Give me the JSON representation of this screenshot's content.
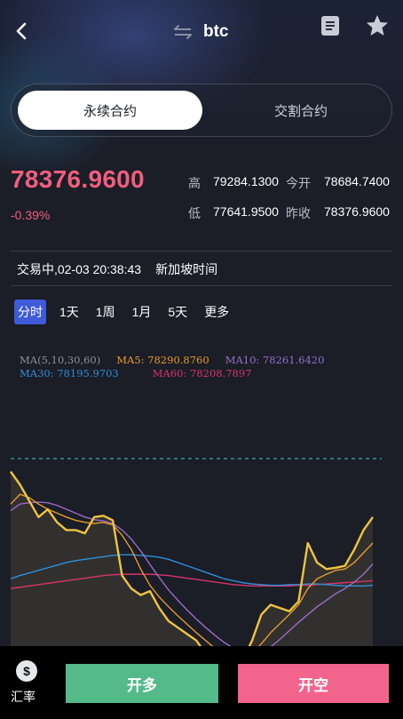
{
  "header": {
    "title": "btc",
    "back_icon": "chevron-left-icon",
    "swap_icon": "swap-arrows-icon",
    "doc_icon": "document-icon",
    "star_icon": "star-icon"
  },
  "tabs": [
    {
      "label": "永续合约",
      "active": true
    },
    {
      "label": "交割合约",
      "active": false
    }
  ],
  "quote": {
    "price": "78376.9600",
    "change": "-0.39%",
    "high_label": "高",
    "high": "79284.1300",
    "open_label": "今开",
    "open": "78684.7400",
    "low_label": "低",
    "low": "77641.9500",
    "prev_close_label": "昨收",
    "prev_close": "78376.9600"
  },
  "status": {
    "text": "交易中,02-03 20:38:43",
    "timezone": "新加坡时间"
  },
  "periods": [
    {
      "label": "分时",
      "active": true
    },
    {
      "label": "1天",
      "active": false
    },
    {
      "label": "1周",
      "active": false
    },
    {
      "label": "1月",
      "active": false
    },
    {
      "label": "5天",
      "active": false
    },
    {
      "label": "更多",
      "active": false
    }
  ],
  "ma_legend": {
    "ma_all": "MA(5,10,30,60)",
    "ma5": "MA5: 78290.8760",
    "ma10": "MA10: 78261.6420",
    "ma30": "MA30: 78195.9703",
    "ma60": "MA60: 78208.7897"
  },
  "colors": {
    "price": "#f0c43d",
    "ma5": "#e69b2c",
    "ma10": "#9b6cc8",
    "ma30": "#2f8fd9",
    "ma60": "#d8356a",
    "up": "#55ba8a",
    "down": "#f2648c"
  },
  "chart_data": {
    "type": "line",
    "ylim": [
      78150,
      78440
    ],
    "x_count": 40,
    "series": [
      {
        "key": "price",
        "values": [
          78420,
          78400,
          78375,
          78350,
          78362,
          78342,
          78330,
          78330,
          78325,
          78350,
          78352,
          78345,
          78260,
          78240,
          78230,
          78236,
          78210,
          78190,
          78180,
          78170,
          78160,
          78140,
          78130,
          78125,
          78120,
          78130,
          78160,
          78200,
          78215,
          78210,
          78205,
          78220,
          78310,
          78280,
          78270,
          78272,
          78275,
          78300,
          78330,
          78350
        ]
      },
      {
        "key": "ma5",
        "values": [
          78370,
          78385,
          78380,
          78370,
          78362,
          78356,
          78350,
          78345,
          78342,
          78340,
          78342,
          78338,
          78322,
          78300,
          78270,
          78245,
          78227,
          78212,
          78198,
          78185,
          78172,
          78160,
          78148,
          78140,
          78135,
          78133,
          78140,
          78155,
          78172,
          78186,
          78200,
          78215,
          78240,
          78255,
          78262,
          78268,
          78270,
          78280,
          78295,
          78310
        ]
      },
      {
        "key": "ma10",
        "values": [
          78360,
          78370,
          78372,
          78373,
          78372,
          78368,
          78362,
          78356,
          78350,
          78346,
          78344,
          78340,
          78330,
          78316,
          78298,
          78277,
          78257,
          78238,
          78222,
          78207,
          78193,
          78180,
          78168,
          78157,
          78148,
          78142,
          78140,
          78143,
          78150,
          78162,
          78175,
          78188,
          78200,
          78212,
          78222,
          78232,
          78240,
          78250,
          78262,
          78278
        ]
      },
      {
        "key": "ma30",
        "values": [
          78255,
          78260,
          78264,
          78268,
          78272,
          78276,
          78280,
          78283,
          78285,
          78287,
          78289,
          78291,
          78292,
          78292,
          78291,
          78290,
          78288,
          78285,
          78280,
          78275,
          78270,
          78265,
          78260,
          78255,
          78252,
          78249,
          78247,
          78246,
          78245,
          78245,
          78246,
          78246,
          78247,
          78247,
          78246,
          78245,
          78244,
          78244,
          78244,
          78245
        ]
      },
      {
        "key": "ma60",
        "values": [
          78240,
          78242,
          78244,
          78246,
          78248,
          78250,
          78252,
          78254,
          78256,
          78258,
          78260,
          78261,
          78262,
          78262,
          78262,
          78262,
          78261,
          78260,
          78258,
          78256,
          78254,
          78252,
          78250,
          78248,
          78246,
          78245,
          78244,
          78244,
          78244,
          78244,
          78244,
          78245,
          78245,
          78246,
          78247,
          78248,
          78249,
          78250,
          78251,
          78252
        ]
      }
    ]
  },
  "bottom": {
    "fx_icon_glyph": "$",
    "fx_label": "汇率",
    "long_label": "开多",
    "short_label": "开空"
  }
}
